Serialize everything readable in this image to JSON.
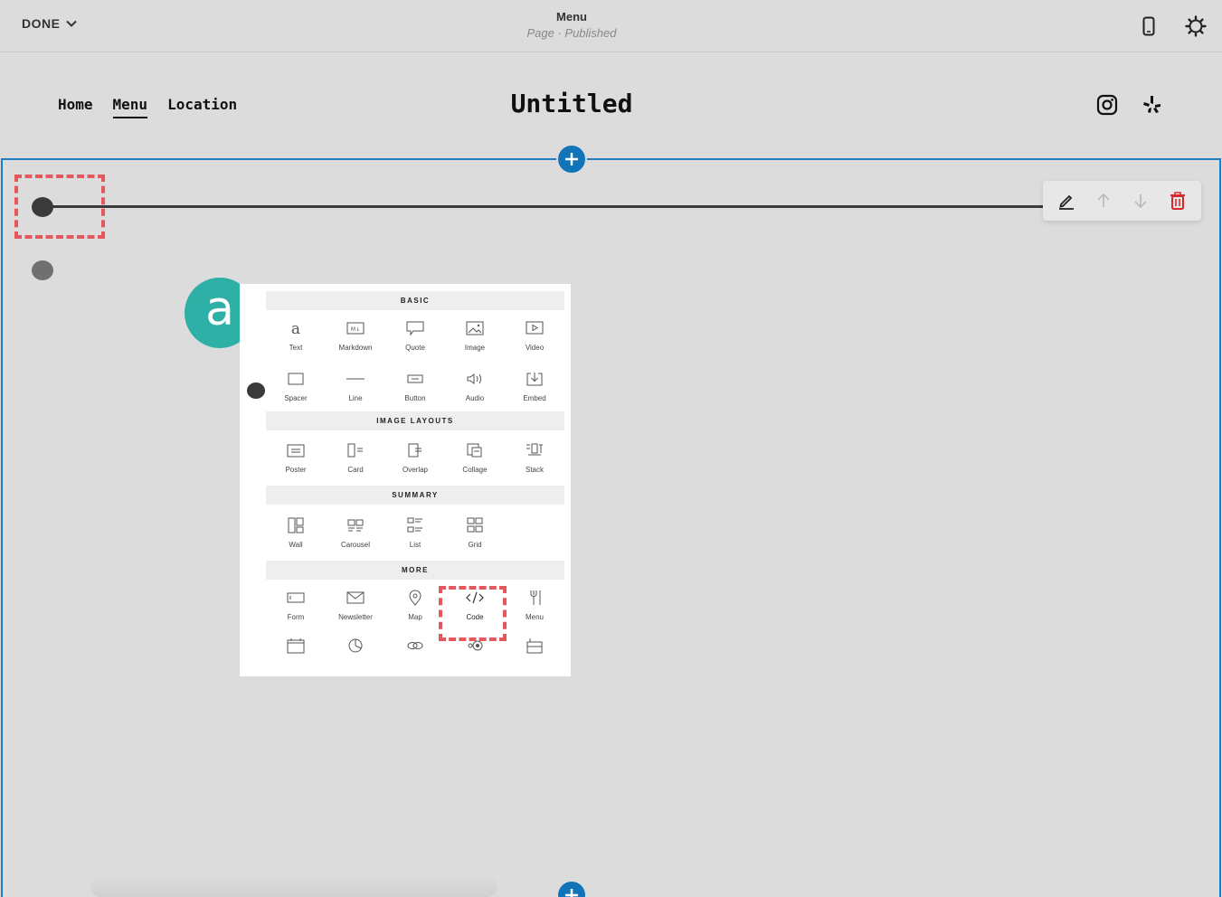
{
  "topbar": {
    "done_label": "DONE",
    "page_name": "Menu",
    "page_status": "Page · Published",
    "mobile_icon": "mobile-preview-icon",
    "settings_icon": "gear-icon"
  },
  "site": {
    "nav": [
      {
        "label": "Home",
        "active": false
      },
      {
        "label": "Menu",
        "active": true
      },
      {
        "label": "Location",
        "active": false
      }
    ],
    "title": "Untitled",
    "social": [
      "instagram-icon",
      "yelp-icon"
    ]
  },
  "block_toolbar": {
    "icons": [
      "pencil-icon",
      "arrow-up-icon",
      "arrow-down-icon",
      "trash-icon"
    ],
    "delete_color": "#d9262c"
  },
  "callout": {
    "label": "a"
  },
  "picker": {
    "categories": [
      {
        "name": "BASIC",
        "items": [
          "Text",
          "Markdown",
          "Quote",
          "Image",
          "Video",
          "Spacer",
          "Line",
          "Button",
          "Audio",
          "Embed"
        ]
      },
      {
        "name": "IMAGE LAYOUTS",
        "items": [
          "Poster",
          "Card",
          "Overlap",
          "Collage",
          "Stack"
        ]
      },
      {
        "name": "SUMMARY",
        "items": [
          "Wall",
          "Carousel",
          "List",
          "Grid"
        ]
      },
      {
        "name": "MORE",
        "items": [
          "Form",
          "Newsletter",
          "Map",
          "Code",
          "Menu"
        ]
      }
    ],
    "highlighted_item": "Code"
  },
  "colors": {
    "accent": "#1174b8",
    "highlight": "#e4575f",
    "callout": "#2eb0a6"
  }
}
